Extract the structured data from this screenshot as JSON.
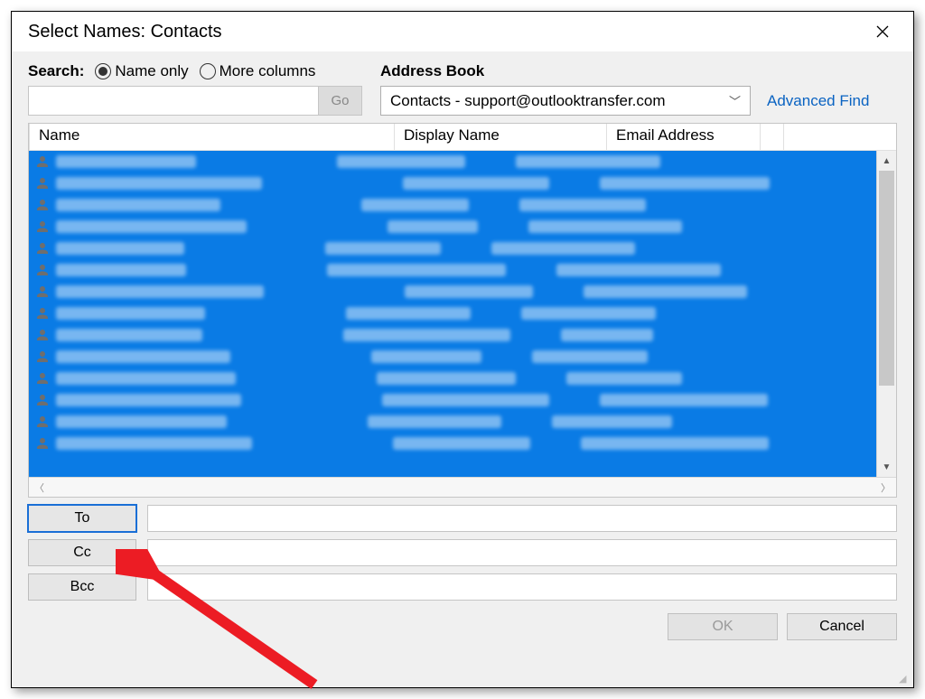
{
  "title": "Select Names: Contacts",
  "search": {
    "label": "Search:",
    "radios": {
      "name_only": "Name only",
      "more_columns": "More columns"
    },
    "selected_radio": "name_only",
    "input_value": "",
    "go_label": "Go"
  },
  "address_book": {
    "label": "Address Book",
    "selected": "Contacts - support@outlooktransfer.com",
    "advanced_find": "Advanced Find"
  },
  "columns": {
    "name": "Name",
    "display": "Display Name",
    "email": "Email Address"
  },
  "visible_row_count": 14,
  "recipients": {
    "to": {
      "label": "To",
      "value": ""
    },
    "cc": {
      "label": "Cc",
      "value": ""
    },
    "bcc": {
      "label": "Bcc",
      "value": ""
    }
  },
  "buttons": {
    "ok": "OK",
    "cancel": "Cancel"
  }
}
